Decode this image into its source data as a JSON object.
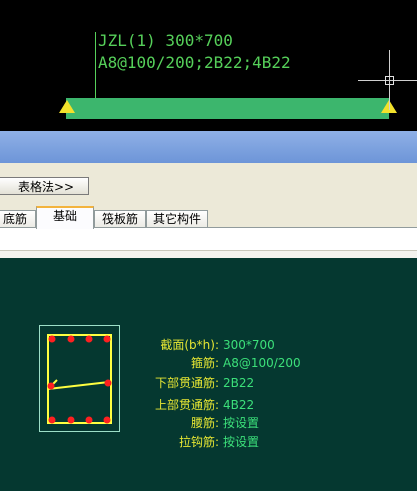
{
  "beam": {
    "label_line1": "JZL(1)  300*700",
    "label_line2": "A8@100/200;2B22;4B22"
  },
  "toolbar": {
    "table_method_label": "表格法>>"
  },
  "tabs": [
    {
      "label": "底筋",
      "active": false
    },
    {
      "label": "基础",
      "active": true
    },
    {
      "label": "筏板筋",
      "active": false
    },
    {
      "label": "其它构件",
      "active": false
    }
  ],
  "section": {
    "properties": [
      {
        "label": "截面(b*h):",
        "value": "300*700"
      },
      {
        "label": "箍筋:",
        "value": "A8@100/200"
      },
      {
        "label": "下部贯通筋:",
        "value": "2B22"
      },
      {
        "label": "上部贯通筋:",
        "value": "4B22"
      },
      {
        "label": "腰筋:",
        "value": "按设置"
      },
      {
        "label": "拉钩筋:",
        "value": "按设置"
      }
    ]
  },
  "colors": {
    "beam": "#3cb66d",
    "annotation": "#56d05a",
    "support": "#f2e12b",
    "preview_bg": "#053830",
    "rebar": "#ff2020",
    "stirrup": "#ffff40"
  }
}
